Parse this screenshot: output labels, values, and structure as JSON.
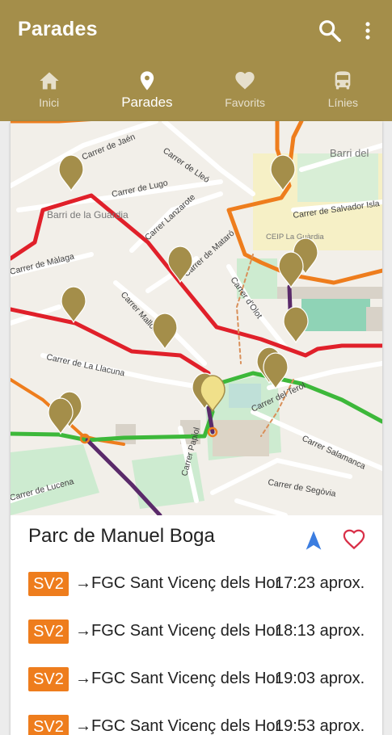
{
  "app": {
    "title": "Parades"
  },
  "toolbar_icons": [
    "search-icon",
    "more-vert-icon"
  ],
  "tabs": [
    {
      "label": "Inici",
      "icon": "home-icon",
      "active": false
    },
    {
      "label": "Parades",
      "icon": "location-pin-icon",
      "active": true
    },
    {
      "label": "Favorits",
      "icon": "heart-icon",
      "active": false
    },
    {
      "label": "Línies",
      "icon": "bus-icon",
      "active": false
    }
  ],
  "map": {
    "street_labels": [
      "Carrer de Jaén",
      "Carrer de Lleó",
      "Carrer de Lugo",
      "Barri de la Guàrdia",
      "Carrer Lanzarote",
      "Carrer de Mataró",
      "Carrer de Màlaga",
      "Carrer Mallorca",
      "Carrer d'Olot",
      "Carrer de La Llacuna",
      "Carrer del Terol",
      "Carrer Salamanca",
      "Carrer Papiol",
      "Carrer de Segòvia",
      "Carrer de Lucena",
      "Carrer de Salvador Isla",
      "CEIP La Guàrdia",
      "Barri del"
    ]
  },
  "stop": {
    "name": "Parc de Manuel Boga",
    "icons": [
      "navigation-arrow-icon",
      "heart-outline-icon"
    ]
  },
  "departures": [
    {
      "line": "SV2",
      "arrow": "→",
      "destination": "FGC Sant Vicenç dels Horts",
      "time": "17:23 aprox."
    },
    {
      "line": "SV2",
      "arrow": "→",
      "destination": "FGC Sant Vicenç dels Horts",
      "time": "18:13 aprox."
    },
    {
      "line": "SV2",
      "arrow": "→",
      "destination": "FGC Sant Vicenç dels Horts",
      "time": "19:03 aprox."
    },
    {
      "line": "SV2",
      "arrow": "→",
      "destination": "FGC Sant Vicenç dels Horts",
      "time": "19:53 aprox."
    }
  ],
  "colors": {
    "appbar": "#a48e4a",
    "line_badge": "#ee7d1d",
    "route_red": "#e0202a",
    "route_orange": "#ee7d1d",
    "route_green": "#3db83a",
    "route_purple": "#5a2a6a",
    "stop_marker": "#a48e4a",
    "selected_marker": "#f0e08a",
    "nav_arrow": "#3b7de0",
    "heart": "#d93048"
  }
}
